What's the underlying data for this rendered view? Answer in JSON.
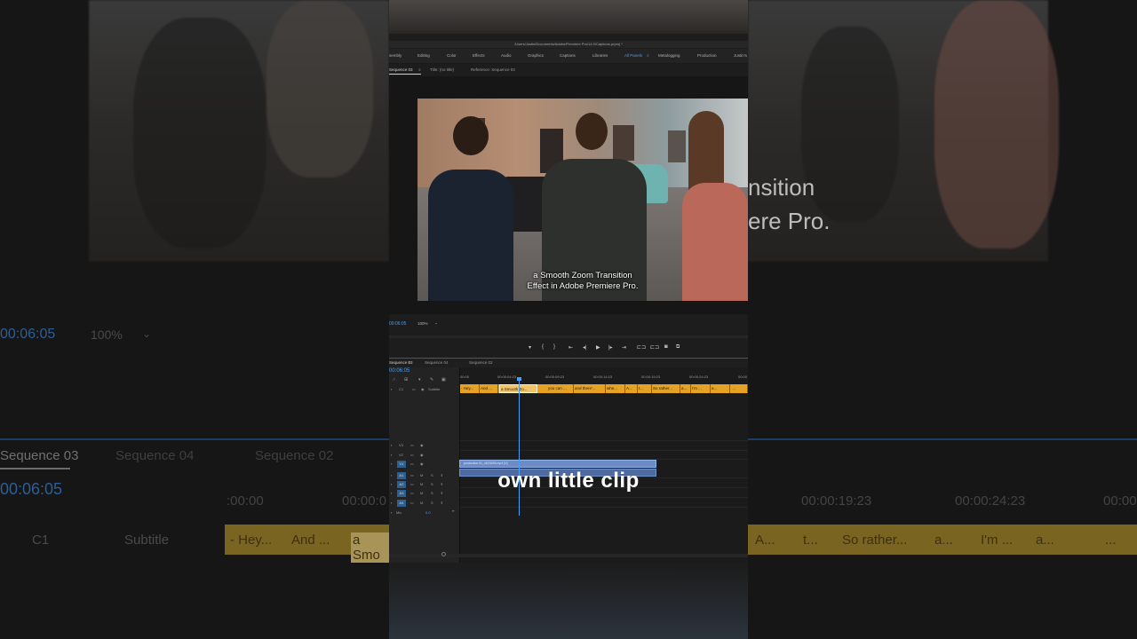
{
  "background_left": {
    "timecode": "00:06:05",
    "zoom": "100%",
    "tabs": [
      "Sequence 03",
      "Sequence 04",
      "Sequence 02"
    ],
    "ruler_start": ":00:00",
    "ruler_mid": "00:00:0",
    "track_label_c1": "C1",
    "track_label_subtitle": "Subtitle",
    "clips": [
      "- Hey...",
      "And ...",
      "a Smo"
    ]
  },
  "background_right": {
    "caption_line1": "nsition",
    "caption_line2": "ere Pro.",
    "ruler": [
      "00:00:19:23",
      "00:00:24:23",
      "00:00:"
    ],
    "clips": [
      "A...",
      "t...",
      "So rather...",
      "a...",
      "I'm ...",
      "a...",
      "..."
    ]
  },
  "app": {
    "title": "/Users/Justin/Documents/Adobe/Premiere Pro/14.0/Captions.prproj *",
    "workspaces": [
      {
        "label": "sembly",
        "active": false
      },
      {
        "label": "Editing",
        "active": false
      },
      {
        "label": "Color",
        "active": false
      },
      {
        "label": "Effects",
        "active": false
      },
      {
        "label": "Audio",
        "active": false
      },
      {
        "label": "Graphics",
        "active": false
      },
      {
        "label": "Captions",
        "active": false
      },
      {
        "label": "Libraries",
        "active": false
      },
      {
        "label": "All Panels",
        "active": true
      },
      {
        "label": "Metalogging",
        "active": false
      },
      {
        "label": "Production",
        "active": false
      },
      {
        "label": "Justin's",
        "active": false
      }
    ],
    "panel_tabs": [
      "Sequence 03",
      "Title: (no title)",
      "Reference: Sequence 03"
    ],
    "video_caption": {
      "line1": "a Smooth Zoom Transition",
      "line2": "Effect in Adobe Premiere Pro."
    },
    "monitor_timecode": "00:06:05",
    "monitor_zoom": "100%",
    "sequence_tabs": [
      "Sequence 03",
      "Sequence 04",
      "Sequence 02"
    ],
    "timeline_timecode": "00:06:05",
    "ruler": [
      "00:00",
      "00:00:04:23",
      "00:00:09:23",
      "00:00:14:23",
      "00:00:19:23",
      "00:00:24:23",
      "00:00"
    ],
    "subtitle_track_label": "Subtitle",
    "subtitle_clips": [
      "- Hey...",
      "And ...",
      "a Smooth Zo...",
      "you can ...",
      "and there'...",
      "whe...",
      "A...",
      "t...",
      "So rather...",
      "a...",
      "I'm ...",
      "a...",
      "..."
    ],
    "tracks": {
      "v3": "V3",
      "v2": "V2",
      "v1": "V1",
      "a1": "A1",
      "a2": "A2",
      "a3": "A3",
      "a4": "A4",
      "mix": "Mix",
      "mix_value": "0.0",
      "m": "M",
      "s": "S"
    },
    "video_clip_name": "production ID_4623295.mp4 [V]"
  },
  "overlay_caption": "own little clip",
  "colors": {
    "accent_blue": "#4c9df2",
    "subtitle_clip": "#e6a323",
    "video_clip": "#6d8cc4"
  }
}
